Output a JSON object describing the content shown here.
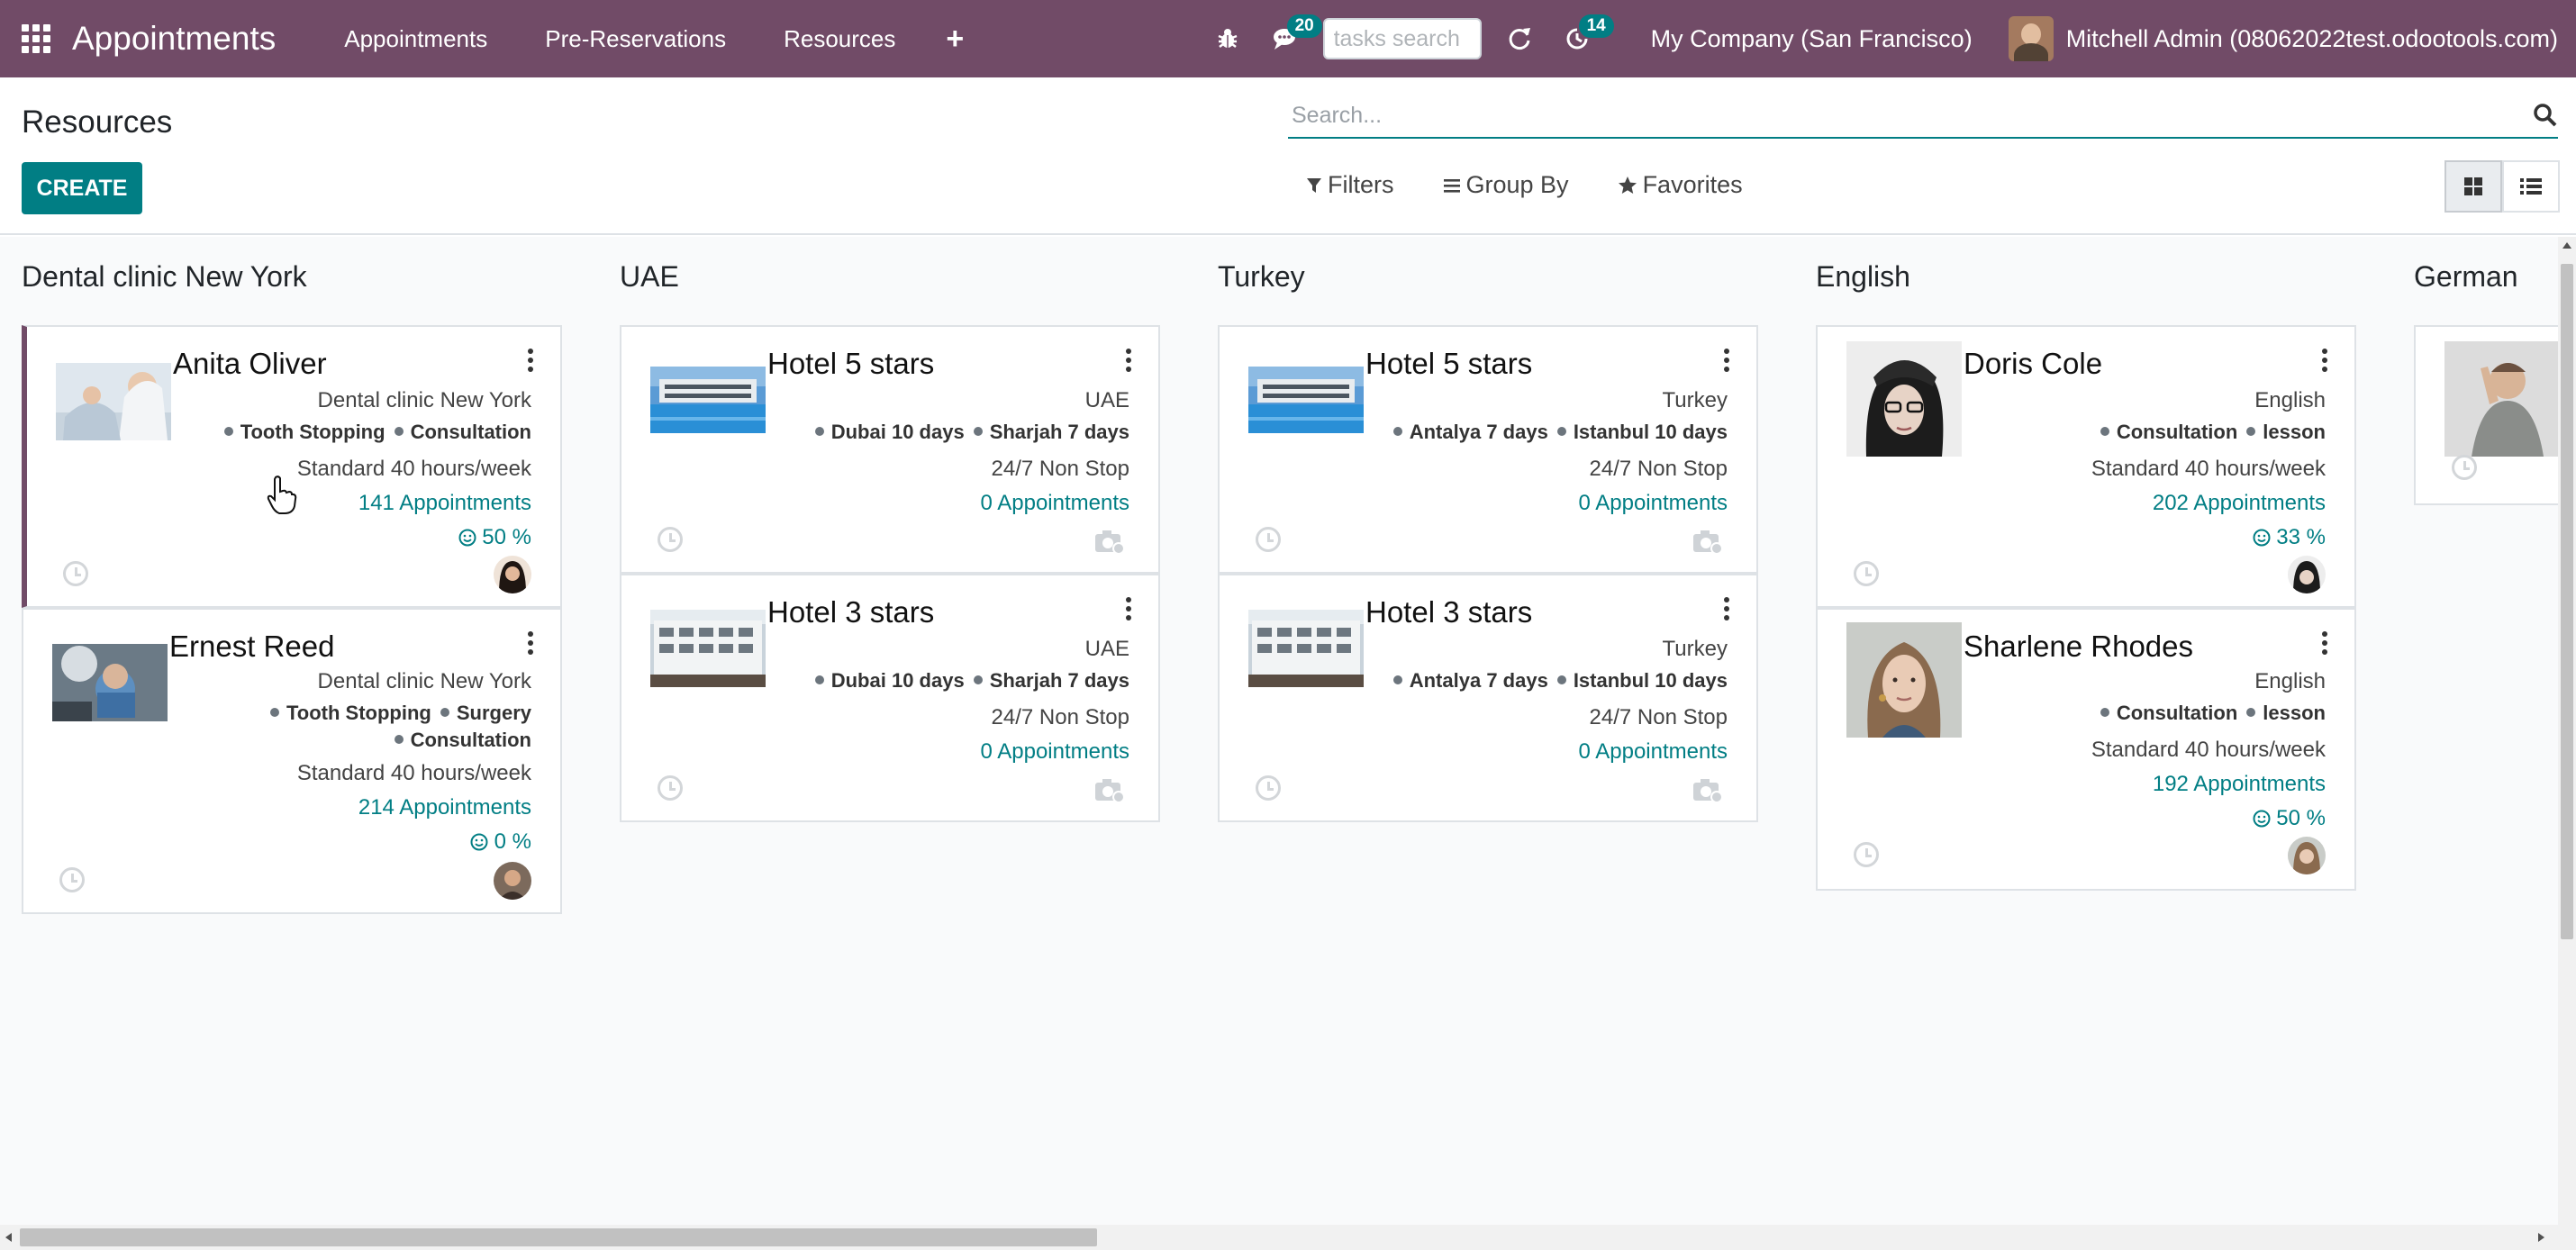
{
  "navbar": {
    "brand": "Appointments",
    "menu": [
      "Appointments",
      "Pre-Reservations",
      "Resources"
    ],
    "plus": "+",
    "messages_count": "20",
    "activities_count": "14",
    "tasks_search_placeholder": "tasks search",
    "company": "My Company (San Francisco)",
    "user": "Mitchell Admin (08062022test.odootools.com)"
  },
  "control": {
    "title": "Resources",
    "create_label": "CREATE",
    "search_placeholder": "Search...",
    "filters_label": "Filters",
    "groupby_label": "Group By",
    "favorites_label": "Favorites"
  },
  "columns": [
    {
      "title": "Dental clinic New York",
      "cards": [
        {
          "name": "Anita Oliver",
          "location": "Dental clinic New York",
          "tags": [
            "Tooth Stopping",
            "Consultation"
          ],
          "schedule": "Standard 40 hours/week",
          "appointments": "141 Appointments",
          "rating": "50 %"
        },
        {
          "name": "Ernest Reed",
          "location": "Dental clinic New York",
          "tags": [
            "Tooth Stopping",
            "Surgery",
            "Consultation"
          ],
          "schedule": "Standard 40 hours/week",
          "appointments": "214 Appointments",
          "rating": "0 %"
        }
      ]
    },
    {
      "title": "UAE",
      "cards": [
        {
          "name": "Hotel 5 stars",
          "location": "UAE",
          "tags": [
            "Dubai 10 days",
            "Sharjah 7 days"
          ],
          "schedule": "24/7 Non Stop",
          "appointments": "0 Appointments"
        },
        {
          "name": "Hotel 3 stars",
          "location": "UAE",
          "tags": [
            "Dubai 10 days",
            "Sharjah 7 days"
          ],
          "schedule": "24/7 Non Stop",
          "appointments": "0 Appointments"
        }
      ]
    },
    {
      "title": "Turkey",
      "cards": [
        {
          "name": "Hotel 5 stars",
          "location": "Turkey",
          "tags": [
            "Antalya 7 days",
            "Istanbul 10 days"
          ],
          "schedule": "24/7 Non Stop",
          "appointments": "0 Appointments"
        },
        {
          "name": "Hotel 3 stars",
          "location": "Turkey",
          "tags": [
            "Antalya 7 days",
            "Istanbul 10 days"
          ],
          "schedule": "24/7 Non Stop",
          "appointments": "0 Appointments"
        }
      ]
    },
    {
      "title": "English",
      "cards": [
        {
          "name": "Doris Cole",
          "location": "English",
          "tags": [
            "Consultation",
            "lesson"
          ],
          "schedule": "Standard 40 hours/week",
          "appointments": "202 Appointments",
          "rating": "33 %"
        },
        {
          "name": "Sharlene Rhodes",
          "location": "English",
          "tags": [
            "Consultation",
            "lesson"
          ],
          "schedule": "Standard 40 hours/week",
          "appointments": "192 Appointments",
          "rating": "50 %"
        }
      ]
    },
    {
      "title": "German",
      "cards": []
    }
  ],
  "colors": {
    "brand": "#714b67",
    "accent": "#017e84"
  }
}
